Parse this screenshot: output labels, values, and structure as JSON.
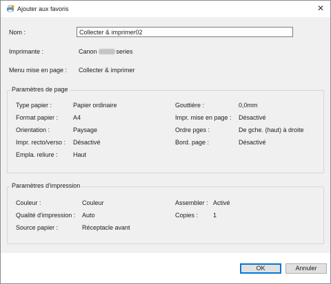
{
  "window": {
    "title": "Ajouter aux favoris",
    "app_icon": "printer-favorites-icon",
    "close_glyph": "✕"
  },
  "header": {
    "name_label": "Nom :",
    "name_value": "Collecter & imprimer02",
    "printer_label": "Imprimante :",
    "printer_prefix": "Canon",
    "printer_suffix": "series",
    "layout_label": "Menu mise en page :",
    "layout_value": "Collecter & imprimer"
  },
  "page_params": {
    "title": "Paramètres de page",
    "left": [
      {
        "label": "Type papier :",
        "value": "Papier ordinaire"
      },
      {
        "label": "Format papier :",
        "value": "A4"
      },
      {
        "label": "Orientation :",
        "value": "Paysage"
      },
      {
        "label": "Impr. recto/verso :",
        "value": "Désactivé"
      },
      {
        "label": "Empla. reliure :",
        "value": "Haut"
      }
    ],
    "right": [
      {
        "label": "Gouttière :",
        "value": "0,0mm"
      },
      {
        "label": "Impr. mise en page :",
        "value": "Désactivé"
      },
      {
        "label": "Ordre pges :",
        "value": "De gche. (haut) à droite"
      },
      {
        "label": "Bord. page :",
        "value": "Désactivé"
      }
    ]
  },
  "print_params": {
    "title": "Paramètres d'impression",
    "left": [
      {
        "label": "Couleur :",
        "value": "Couleur"
      },
      {
        "label": "Qualité d'impression :",
        "value": "Auto"
      },
      {
        "label": "Source papier :",
        "value": "Réceptacle avant"
      }
    ],
    "right": [
      {
        "label": "Assembler :",
        "value": "Activé"
      },
      {
        "label": "Copies :",
        "value": "1"
      }
    ]
  },
  "footer": {
    "ok_label": "OK",
    "cancel_label": "Annuler"
  },
  "colors": {
    "accent": "#0078d7",
    "dialog_bg": "#f0f0f0"
  }
}
